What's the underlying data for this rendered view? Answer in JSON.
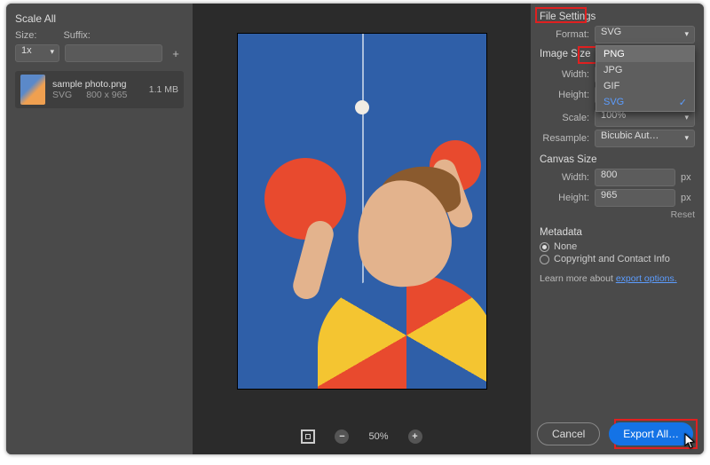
{
  "left_panel": {
    "title": "Scale All",
    "size_label": "Size:",
    "suffix_label": "Suffix:",
    "scale_value": "1x",
    "asset": {
      "name": "sample photo.png",
      "format": "SVG",
      "dimensions": "800 x 965",
      "filesize": "1.1 MB"
    }
  },
  "preview": {
    "zoom_percent": "50%"
  },
  "right_panel": {
    "file_settings_title": "File Settings",
    "format_label": "Format:",
    "format_value": "SVG",
    "format_options": [
      "PNG",
      "JPG",
      "GIF",
      "SVG"
    ],
    "format_highlight": "PNG",
    "format_selected": "SVG",
    "image_size_title": "Image Size",
    "width_label": "Width:",
    "height_label": "Height:",
    "image_width": "",
    "image_height": "",
    "px_unit": "px",
    "scale_label": "Scale:",
    "scale_value": "100%",
    "resample_label": "Resample:",
    "resample_value": "Bicubic Aut…",
    "canvas_size_title": "Canvas Size",
    "canvas_width": "800",
    "canvas_height": "965",
    "reset_label": "Reset",
    "metadata_title": "Metadata",
    "metadata_none": "None",
    "metadata_copyright": "Copyright and Contact Info",
    "learn_prefix": "Learn more about ",
    "learn_link": "export options."
  },
  "buttons": {
    "cancel": "Cancel",
    "export": "Export All…"
  }
}
